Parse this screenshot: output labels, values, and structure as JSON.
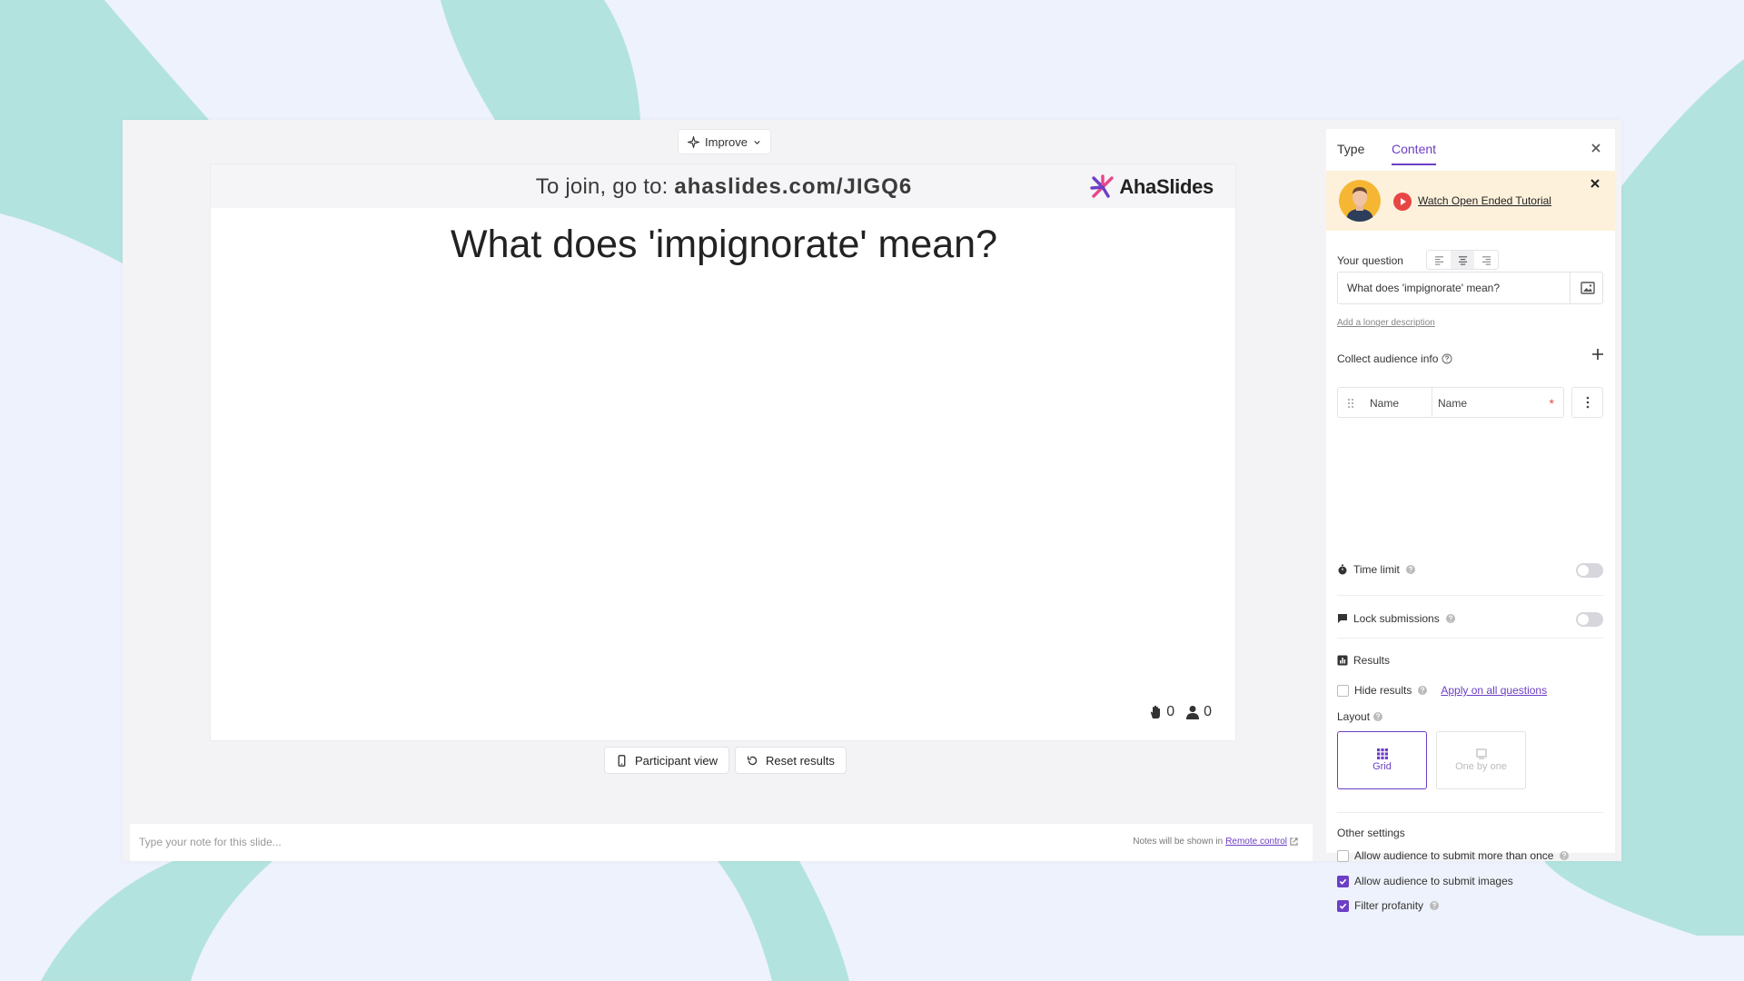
{
  "toolbar": {
    "improve_label": "Improve"
  },
  "slide": {
    "join_prefix": "To join, go to: ",
    "join_url": "ahaslides.com/JIGQ6",
    "brand_name": "AhaSlides",
    "question": "What does 'impignorate' mean?",
    "reactions_count": "0",
    "participants_count": "0"
  },
  "slide_actions": {
    "participant_view_label": "Participant view",
    "reset_results_label": "Reset results"
  },
  "notes": {
    "placeholder": "Type your note for this slide...",
    "hint_prefix": "Notes will be shown in ",
    "remote_control_label": "Remote control"
  },
  "panel": {
    "tabs": [
      {
        "label": "Type"
      },
      {
        "label": "Content"
      }
    ],
    "active_tab": "Content",
    "tutorial": {
      "link_label": "Watch Open Ended Tutorial"
    },
    "your_question_label": "Your question",
    "question_value": "What does 'impignorate' mean?",
    "add_description_label": "Add a longer description",
    "collect_info_label": "Collect audience info",
    "audience_field": {
      "label": "Name",
      "value": "Name",
      "required_mark": "*"
    },
    "time_limit_label": "Time limit",
    "lock_submissions_label": "Lock submissions",
    "results_label": "Results",
    "hide_results_label": "Hide results",
    "apply_all_label": "Apply on all questions",
    "layout_label": "Layout",
    "layout_options": [
      {
        "label": "Grid",
        "selected": true
      },
      {
        "label": "One by one",
        "selected": false
      }
    ],
    "other_settings_label": "Other settings",
    "other_settings": [
      {
        "label": "Allow audience to submit more than once",
        "checked": false
      },
      {
        "label": "Allow audience to submit images",
        "checked": true
      },
      {
        "label": "Filter profanity",
        "checked": true
      }
    ]
  },
  "colors": {
    "accent": "#6c3fc5",
    "background": "#eef2fc",
    "teal_shape": "#b3e3df",
    "banner": "#fdf1dc",
    "required": "#e04848"
  }
}
